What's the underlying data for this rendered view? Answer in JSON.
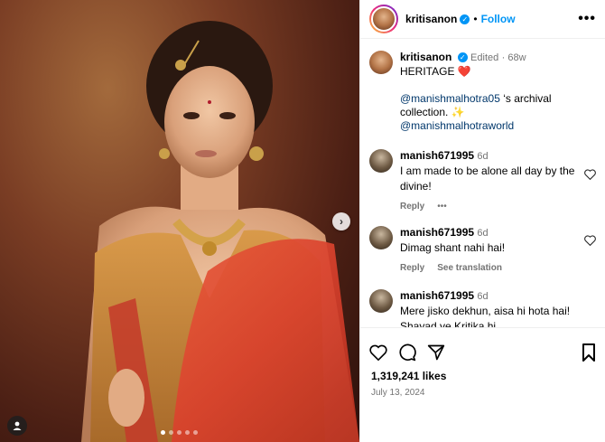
{
  "post": {
    "username": "kritisanon",
    "follow_label": "Follow",
    "more_label": "•••"
  },
  "caption": {
    "username": "kritisanon",
    "edited": "Edited",
    "age": "68w",
    "line1": "HERITAGE ❤️",
    "mention1": "@manishmalhotra05",
    "mention1_suffix": " ‘s archival collection. ✨",
    "mention2": "@manishmalhotraworld"
  },
  "comments": [
    {
      "username": "manish671995",
      "age": "6d",
      "text": "I am made to be alone all day by the divine!",
      "reply": "Reply",
      "extra": "•••"
    },
    {
      "username": "manish671995",
      "age": "6d",
      "text": "Dimag shant nahi hai!",
      "reply": "Reply",
      "extra": "See translation"
    },
    {
      "username": "manish671995",
      "age": "6d",
      "text": "Mere jisko dekhun, aisa hi hota hai! Shayad ye Kritika hi"
    }
  ],
  "footer": {
    "likes": "1,319,241 likes",
    "date": "July 13, 2024"
  },
  "media": {
    "carousel_count": 5,
    "active_index": 0
  },
  "icons": {
    "like": "heart-icon",
    "comment": "comment-icon",
    "share": "share-icon",
    "save": "bookmark-icon",
    "next": "chevron-right-icon",
    "tags": "user-tag-icon"
  },
  "colors": {
    "accent": "#0095f6",
    "secondary_text": "#737373",
    "link": "#00376b"
  }
}
